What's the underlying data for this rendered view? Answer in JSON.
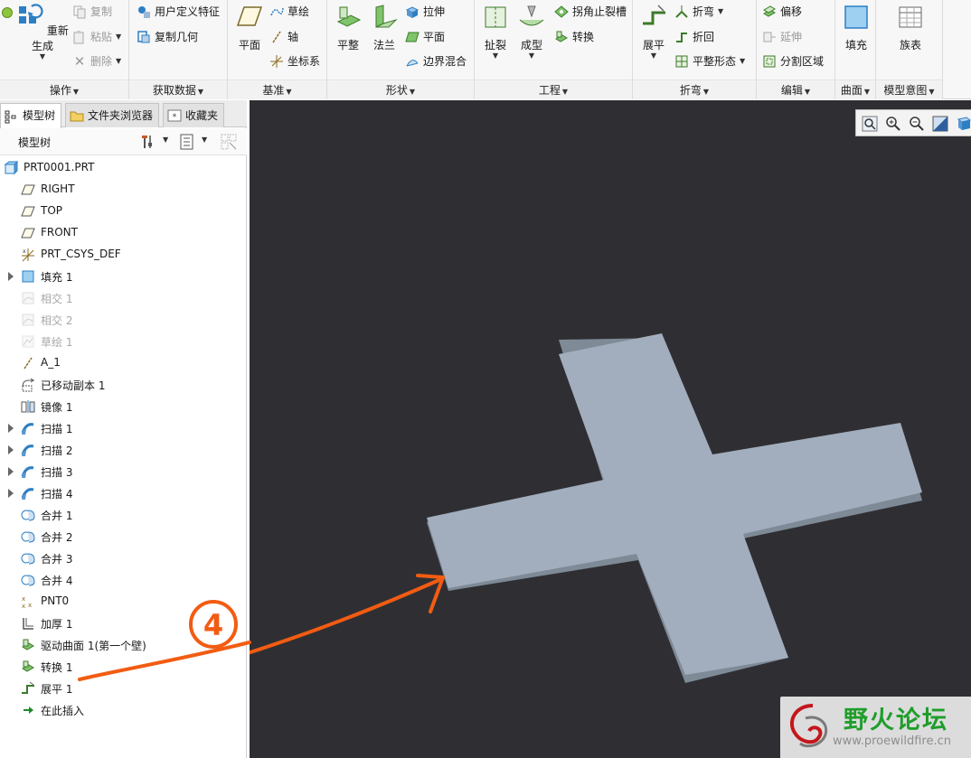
{
  "ribbon": {
    "operations": {
      "label": "操作",
      "regenerate": "重新生成",
      "copy": "复制",
      "paste": "粘贴",
      "delete": "删除"
    },
    "get_data": {
      "label": "获取数据",
      "udf": "用户定义特征",
      "copy_geometry": "复制几何"
    },
    "datum": {
      "label": "基准",
      "plane": "平面",
      "sketch": "草绘",
      "axis": "轴",
      "csys": "坐标系"
    },
    "shapes": {
      "label": "形状",
      "planar": "平整",
      "flange": "法兰",
      "extrude": "拉伸",
      "flat": "平面",
      "boundary_blend": "边界混合"
    },
    "engineering": {
      "label": "工程",
      "rip": "扯裂",
      "form": "成型",
      "corner_relief": "拐角止裂槽",
      "convert": "转换"
    },
    "bends": {
      "label": "折弯",
      "unbend": "展平",
      "bend": "折弯",
      "bend_back": "折回",
      "flat_state": "平整形态"
    },
    "editing": {
      "label": "编辑",
      "offset": "偏移",
      "extend": "延伸",
      "split_area": "分割区域"
    },
    "surfaces": {
      "label": "曲面",
      "fill": "填充"
    },
    "model_intent": {
      "label": "模型意图",
      "family_table": "族表"
    }
  },
  "left_panel": {
    "tabs": [
      "模型树",
      "文件夹浏览器",
      "收藏夹"
    ],
    "tree_title": "模型树",
    "items": [
      {
        "label": "PRT0001.PRT",
        "icon": "part-icon",
        "expandable": false,
        "dim": false
      },
      {
        "label": "RIGHT",
        "icon": "datum-plane-icon",
        "expandable": false,
        "dim": false
      },
      {
        "label": "TOP",
        "icon": "datum-plane-icon",
        "expandable": false,
        "dim": false
      },
      {
        "label": "FRONT",
        "icon": "datum-plane-icon",
        "expandable": false,
        "dim": false
      },
      {
        "label": "PRT_CSYS_DEF",
        "icon": "csys-icon",
        "expandable": false,
        "dim": false
      },
      {
        "label": "填充 1",
        "icon": "fill-icon",
        "expandable": true,
        "dim": false
      },
      {
        "label": "相交 1",
        "icon": "intersect-icon",
        "expandable": false,
        "dim": true
      },
      {
        "label": "相交 2",
        "icon": "intersect-icon",
        "expandable": false,
        "dim": true
      },
      {
        "label": "草绘 1",
        "icon": "sketch-icon",
        "expandable": false,
        "dim": true
      },
      {
        "label": "A_1",
        "icon": "axis-icon",
        "expandable": false,
        "dim": false
      },
      {
        "label": "已移动副本 1",
        "icon": "moved-copy-icon",
        "expandable": false,
        "dim": false
      },
      {
        "label": "镜像 1",
        "icon": "mirror-icon",
        "expandable": false,
        "dim": false
      },
      {
        "label": "扫描 1",
        "icon": "sweep-icon",
        "expandable": true,
        "dim": false
      },
      {
        "label": "扫描 2",
        "icon": "sweep-icon",
        "expandable": true,
        "dim": false
      },
      {
        "label": "扫描 3",
        "icon": "sweep-icon",
        "expandable": true,
        "dim": false
      },
      {
        "label": "扫描 4",
        "icon": "sweep-icon",
        "expandable": true,
        "dim": false
      },
      {
        "label": "合并 1",
        "icon": "merge-icon",
        "expandable": false,
        "dim": false
      },
      {
        "label": "合并 2",
        "icon": "merge-icon",
        "expandable": false,
        "dim": false
      },
      {
        "label": "合并 3",
        "icon": "merge-icon",
        "expandable": false,
        "dim": false
      },
      {
        "label": "合并 4",
        "icon": "merge-icon",
        "expandable": false,
        "dim": false
      },
      {
        "label": "PNT0",
        "icon": "datum-point-icon",
        "expandable": false,
        "dim": false
      },
      {
        "label": "加厚 1",
        "icon": "thicken-icon",
        "expandable": false,
        "dim": false
      },
      {
        "label": "驱动曲面 1(第一个壁)",
        "icon": "driving-surface-icon",
        "expandable": false,
        "dim": false
      },
      {
        "label": "转换 1",
        "icon": "convert-icon",
        "expandable": false,
        "dim": false
      },
      {
        "label": "展平 1",
        "icon": "unbend-icon",
        "expandable": false,
        "dim": false
      },
      {
        "label": "在此插入",
        "icon": "insert-here-icon",
        "expandable": false,
        "dim": false
      }
    ]
  },
  "annotation": {
    "step_number": "4"
  },
  "watermark": {
    "title": "野火论坛",
    "url": "www.proewildfire.cn"
  },
  "colors": {
    "viewport_bg": "#2f2f33",
    "part_fill": "#a2aebd",
    "part_edge": "#7f8a97",
    "annotation": "#f25c12",
    "watermark_green": "#1f9e2a"
  }
}
